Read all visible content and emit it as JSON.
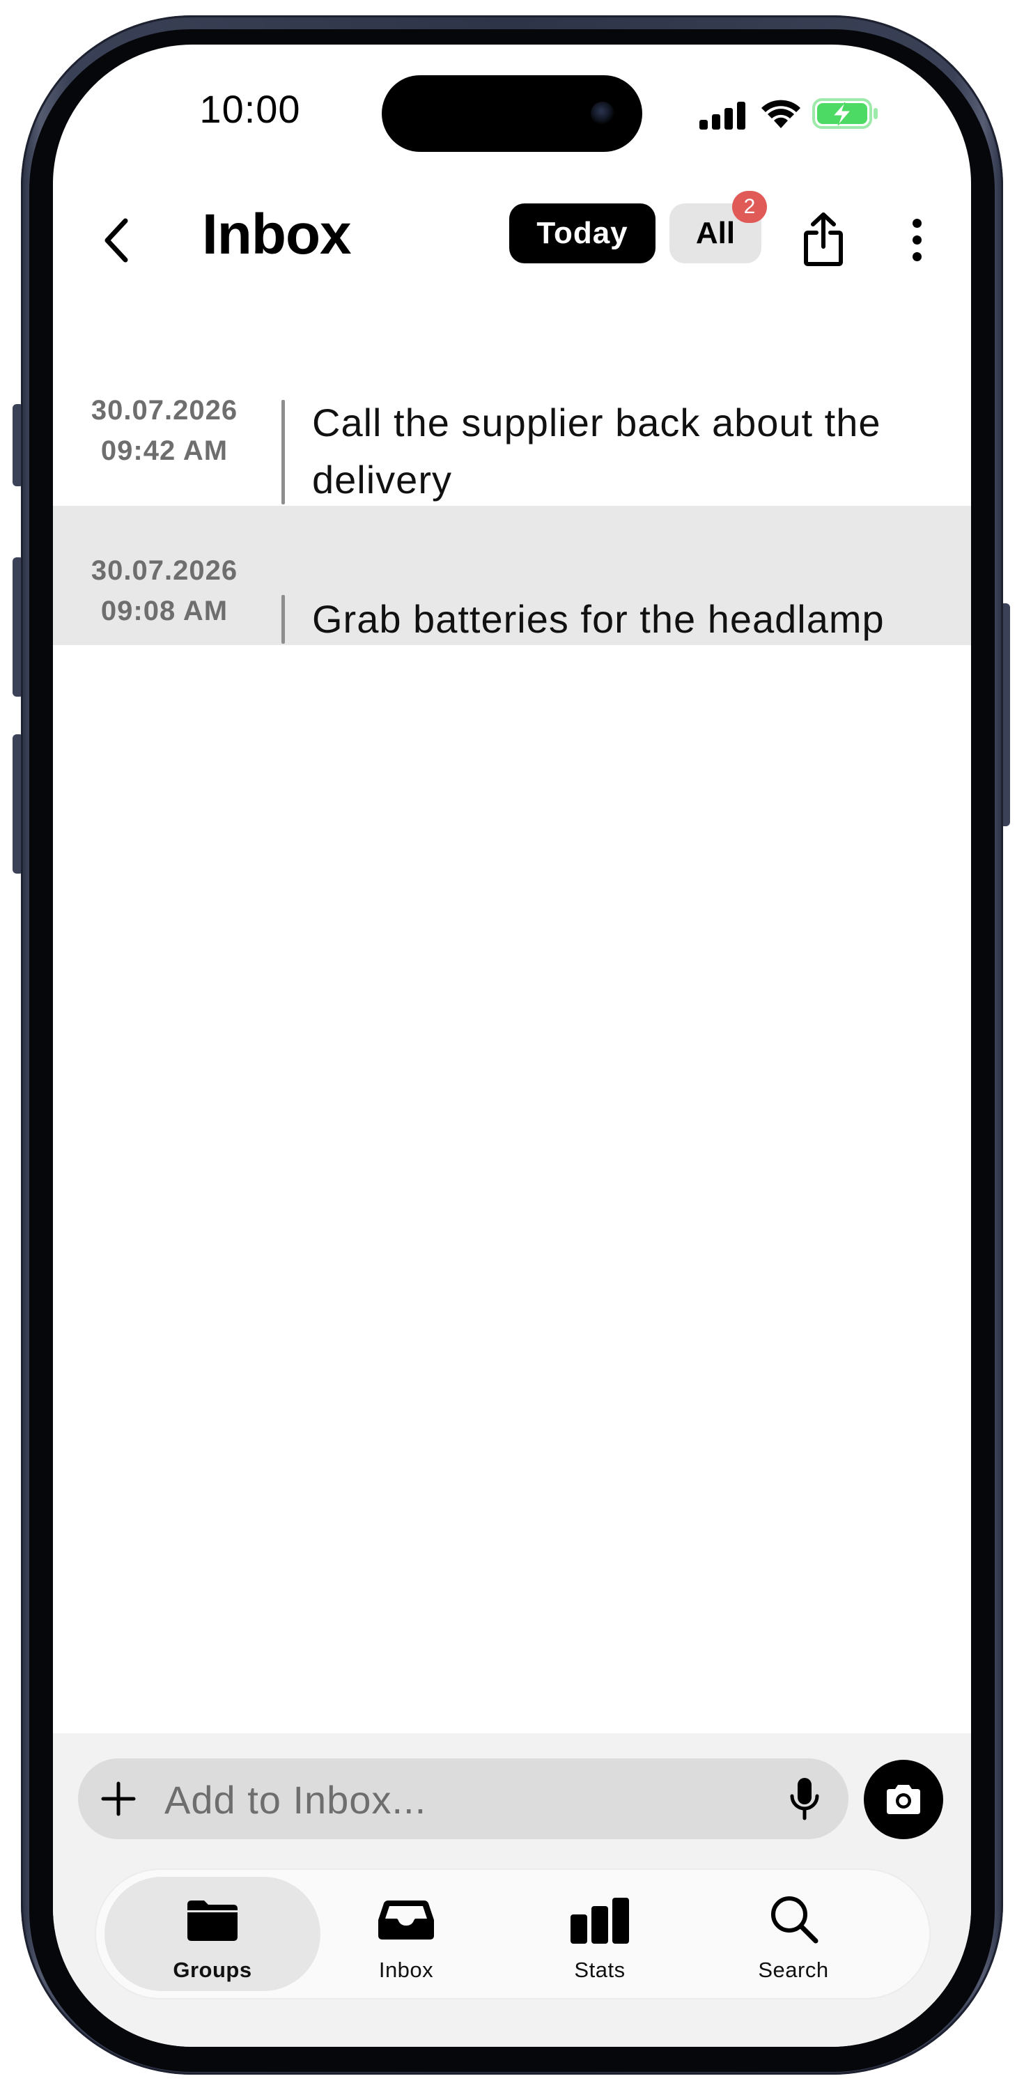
{
  "status_bar": {
    "time": "10:00",
    "icons": [
      "cellular-signal-icon",
      "wifi-icon",
      "battery-charging-icon"
    ]
  },
  "header": {
    "title": "Inbox",
    "back_icon": "chevron-left-icon",
    "filter_today": "Today",
    "filter_all": "All",
    "all_badge_count": "2",
    "share_icon": "share-icon",
    "more_icon": "more-vertical-icon"
  },
  "entries": [
    {
      "date": "30.07.2026",
      "time": "09:42 AM",
      "text": "Call the supplier back about the delivery",
      "selected": false
    },
    {
      "date": "30.07.2026",
      "time": "09:08 AM",
      "text": "Grab batteries for the headlamp",
      "selected": true
    }
  ],
  "composer": {
    "placeholder": "Add to Inbox...",
    "plus_icon": "plus-icon",
    "mic_icon": "microphone-icon",
    "camera_icon": "camera-icon"
  },
  "tabs": [
    {
      "label": "Groups",
      "icon": "folder-icon",
      "active": true
    },
    {
      "label": "Inbox",
      "icon": "inbox-tray-icon",
      "active": false
    },
    {
      "label": "Stats",
      "icon": "bar-chart-icon",
      "active": false
    },
    {
      "label": "Search",
      "icon": "search-icon",
      "active": false
    }
  ],
  "colors": {
    "accent": "#000000",
    "badge": "#e05a57",
    "battery_charge": "#4cd964",
    "selected_row": "#e8e8e8",
    "frame": "#2e3447"
  }
}
